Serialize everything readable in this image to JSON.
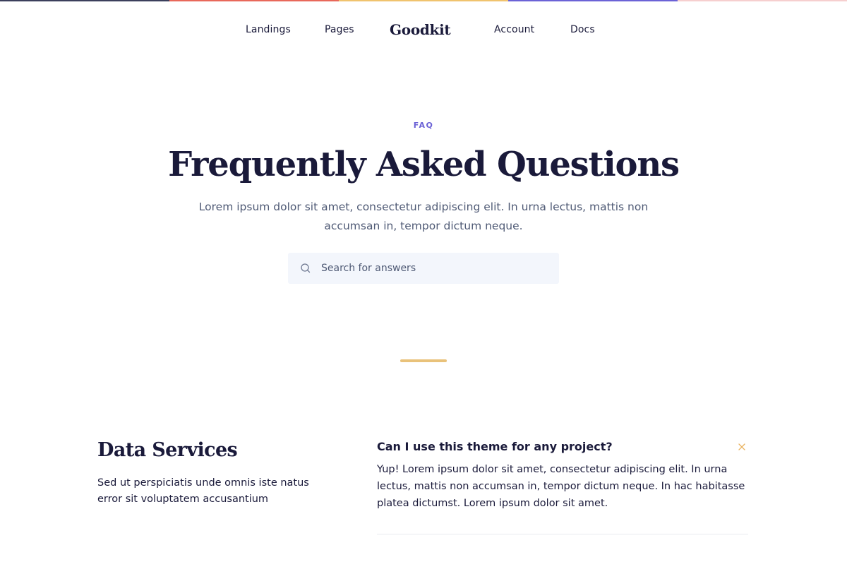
{
  "colors": {
    "strip": [
      "#3b3f5c",
      "#e8685a",
      "#f0c36e",
      "#6b62d6",
      "#f6cfcf"
    ],
    "accent_purple": "#6b62d6",
    "accent_gold": "#e9c27a",
    "close_icon": "#e9b25e",
    "search_icon": "#6e7891"
  },
  "nav": {
    "items": [
      "Landings",
      "Pages",
      "Account",
      "Docs"
    ],
    "logo": "Goodkit"
  },
  "hero": {
    "eyebrow": "FAQ",
    "title": "Frequently Asked Questions",
    "lead": "Lorem ipsum dolor sit amet, consectetur adipiscing elit. In urna lectus, mattis non accumsan in, tempor dictum neque."
  },
  "search": {
    "placeholder": "Search for answers",
    "icon": "search-icon"
  },
  "category": {
    "title": "Data Services",
    "description": "Sed ut perspiciatis unde omnis iste natus error sit voluptatem accusantium"
  },
  "faq": {
    "question": "Can I use this theme for any project?",
    "answer": "Yup! Lorem ipsum dolor sit amet, consectetur adipiscing elit. In urna lectus, mattis non accumsan in, tempor dictum neque. In hac habitasse platea dictumst. Lorem ipsum dolor sit amet.",
    "close_icon": "close-icon"
  }
}
